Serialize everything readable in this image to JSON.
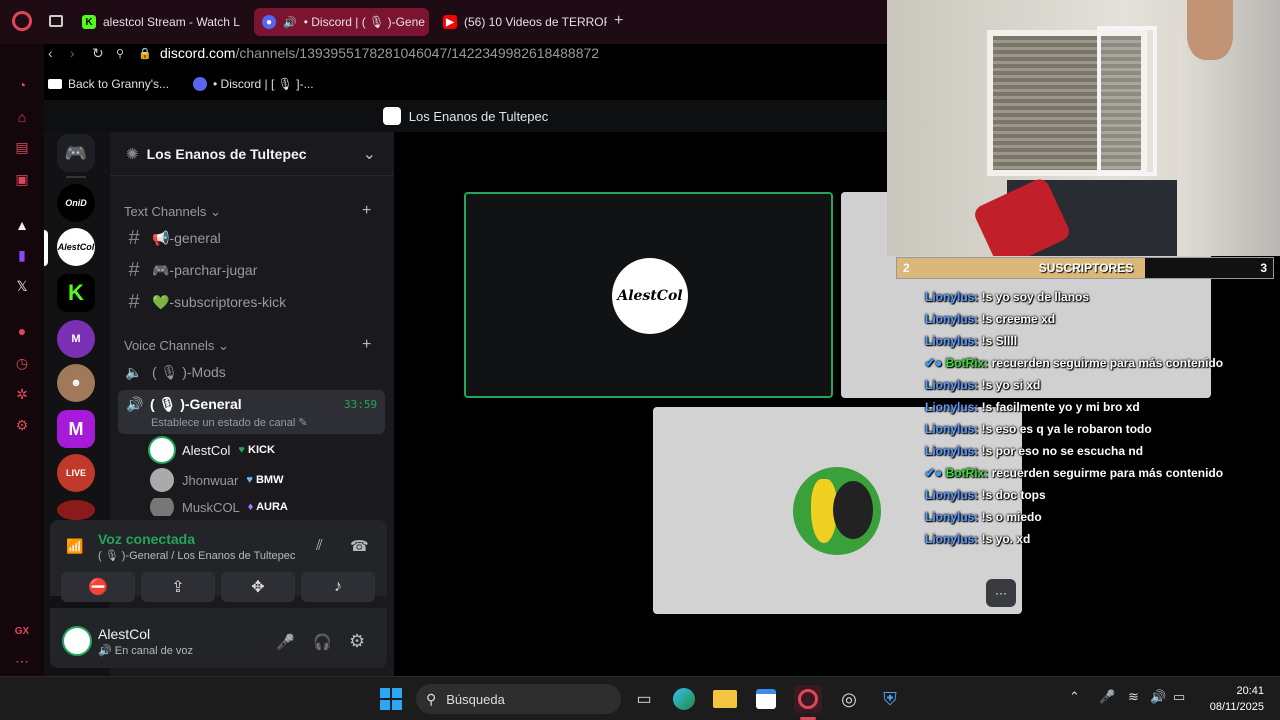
{
  "browser": {
    "tabs": [
      {
        "label": "alestcol Stream - Watch L"
      },
      {
        "label": "• Discord | ( 🎙 )-Gene"
      },
      {
        "label": "(56) 10 Videos de TERROR"
      }
    ],
    "new_tab": "+",
    "url_domain": "discord.com",
    "url_path": "/channels/1393955178281046047/1422349982618488872",
    "bookmarks": [
      {
        "label": "Back to Granny's..."
      },
      {
        "label": "• Discord | [ 🎙 ]-..."
      }
    ]
  },
  "discord": {
    "window_title": "Los Enanos de Tultepec",
    "server_name": "Los Enanos de Tultepec",
    "text_category": "Text Channels",
    "text_channels": [
      {
        "label": "📢-general"
      },
      {
        "label": "🎮-parchar-jugar"
      },
      {
        "label": "💚-subscriptores-kick"
      }
    ],
    "voice_category": "Voice Channels",
    "voice_channels": [
      {
        "label": "( 🎙 )-Mods"
      },
      {
        "label": "( 🎙 )-General",
        "timer": "33:59",
        "status": "Establece un estado de canal"
      }
    ],
    "voice_users": [
      {
        "name": "AlestCol",
        "badge": "KICK"
      },
      {
        "name": "Jhonwuar",
        "badge": "BMW"
      },
      {
        "name": "MuskCOL",
        "badge": "AURA"
      }
    ],
    "connection": {
      "status": "Voz conectada",
      "detail": "( 🎙 )-General / Los Enanos de Tultepec"
    },
    "user_panel": {
      "name": "AlestCol",
      "status": "En canal de voz"
    },
    "video_tile_logo": "AlestCol",
    "more_button": "···"
  },
  "overlay": {
    "subs_left": "2",
    "subs_label": "SUSCRIPTORES",
    "subs_right": "3",
    "subs_progress": 0.66,
    "chat": [
      {
        "user": "Lionylus:",
        "msg": "!s yo soy de llanos",
        "bot": false
      },
      {
        "user": "Lionylus:",
        "msg": "!s creeme xd",
        "bot": false
      },
      {
        "user": "Lionylus:",
        "msg": "!s Sllll",
        "bot": false
      },
      {
        "user": "BotRix:",
        "msg": "recuerden seguirme para más contenido",
        "bot": true
      },
      {
        "user": "Lionylus:",
        "msg": "!s yo si xd",
        "bot": false
      },
      {
        "user": "Lionylus:",
        "msg": "!s facilmente yo y mi bro xd",
        "bot": false
      },
      {
        "user": "Lionylus:",
        "msg": "!s eso es q ya le robaron todo",
        "bot": false
      },
      {
        "user": "Lionylus:",
        "msg": "!s por eso no se escucha nd",
        "bot": false
      },
      {
        "user": "BotRix:",
        "msg": "recuerden seguirme para más contenido",
        "bot": true
      },
      {
        "user": "Lionylus:",
        "msg": "!s doc tops",
        "bot": false
      },
      {
        "user": "Lionylus:",
        "msg": "!s o miedo",
        "bot": false
      },
      {
        "user": "Lionylus:",
        "msg": "!s yo. xd",
        "bot": false
      }
    ]
  },
  "taskbar": {
    "search_placeholder": "Búsqueda",
    "time": "20:41",
    "date": "08/11/2025"
  },
  "colors": {
    "discord_green": "#23a55a",
    "opera_red": "#e0455a",
    "chat_user": "#5b9bff",
    "bot_user": "#3ddc3d",
    "kick_green": "#53fc18"
  }
}
